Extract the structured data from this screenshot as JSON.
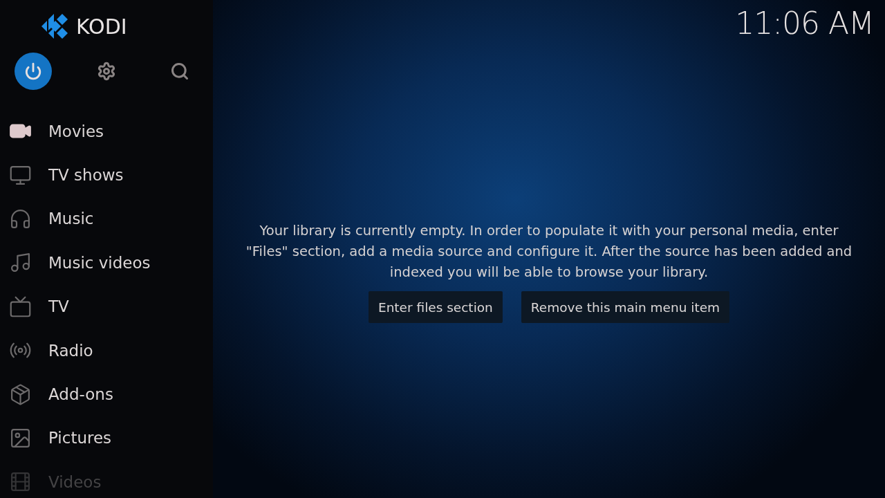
{
  "logo": {
    "text": "KODI"
  },
  "clock": "11:06 AM",
  "top_buttons": [
    {
      "kind": "power",
      "selected": true
    },
    {
      "kind": "settings",
      "selected": false
    },
    {
      "kind": "search",
      "selected": false
    }
  ],
  "menu": [
    {
      "label": "Movies",
      "selected": true,
      "faded": false
    },
    {
      "label": "TV shows",
      "selected": false,
      "faded": false
    },
    {
      "label": "Music",
      "selected": false,
      "faded": false
    },
    {
      "label": "Music videos",
      "selected": false,
      "faded": false
    },
    {
      "label": "TV",
      "selected": false,
      "faded": false
    },
    {
      "label": "Radio",
      "selected": false,
      "faded": false
    },
    {
      "label": "Add-ons",
      "selected": false,
      "faded": false
    },
    {
      "label": "Pictures",
      "selected": false,
      "faded": false
    },
    {
      "label": "Videos",
      "selected": false,
      "faded": true
    }
  ],
  "message": "Your library is currently empty. In order to populate it with your personal media, enter \"Files\" section, add a media source and configure it. After the source has been added and indexed you will be able to browse your library.",
  "buttons": [
    "Enter files section",
    "Remove this main menu item"
  ]
}
